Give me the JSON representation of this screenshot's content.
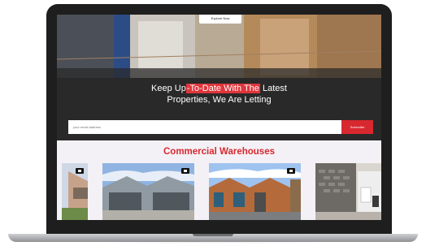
{
  "hero": {
    "explore_label": "Explore Now",
    "headline_pre": "Keep Up",
    "headline_highlight": "-To-Date With The",
    "headline_post": " Latest",
    "headline_line2": "Properties, We Are Letting",
    "email_placeholder": "your email address",
    "subscribe_label": "Subscribe"
  },
  "section": {
    "title": "Commercial Warehouses"
  },
  "colors": {
    "accent": "#d8282f",
    "frame": "#1e1e1e"
  },
  "cards": [
    {
      "image": "warehouse-exterior-partial",
      "badge_icon": "camera-icon"
    },
    {
      "image": "warehouse-yard",
      "badge_icon": "camera-icon"
    },
    {
      "image": "brick-warehouse",
      "badge_icon": "camera-icon"
    },
    {
      "image": "office-interior",
      "badge_icon": "camera-icon"
    }
  ]
}
